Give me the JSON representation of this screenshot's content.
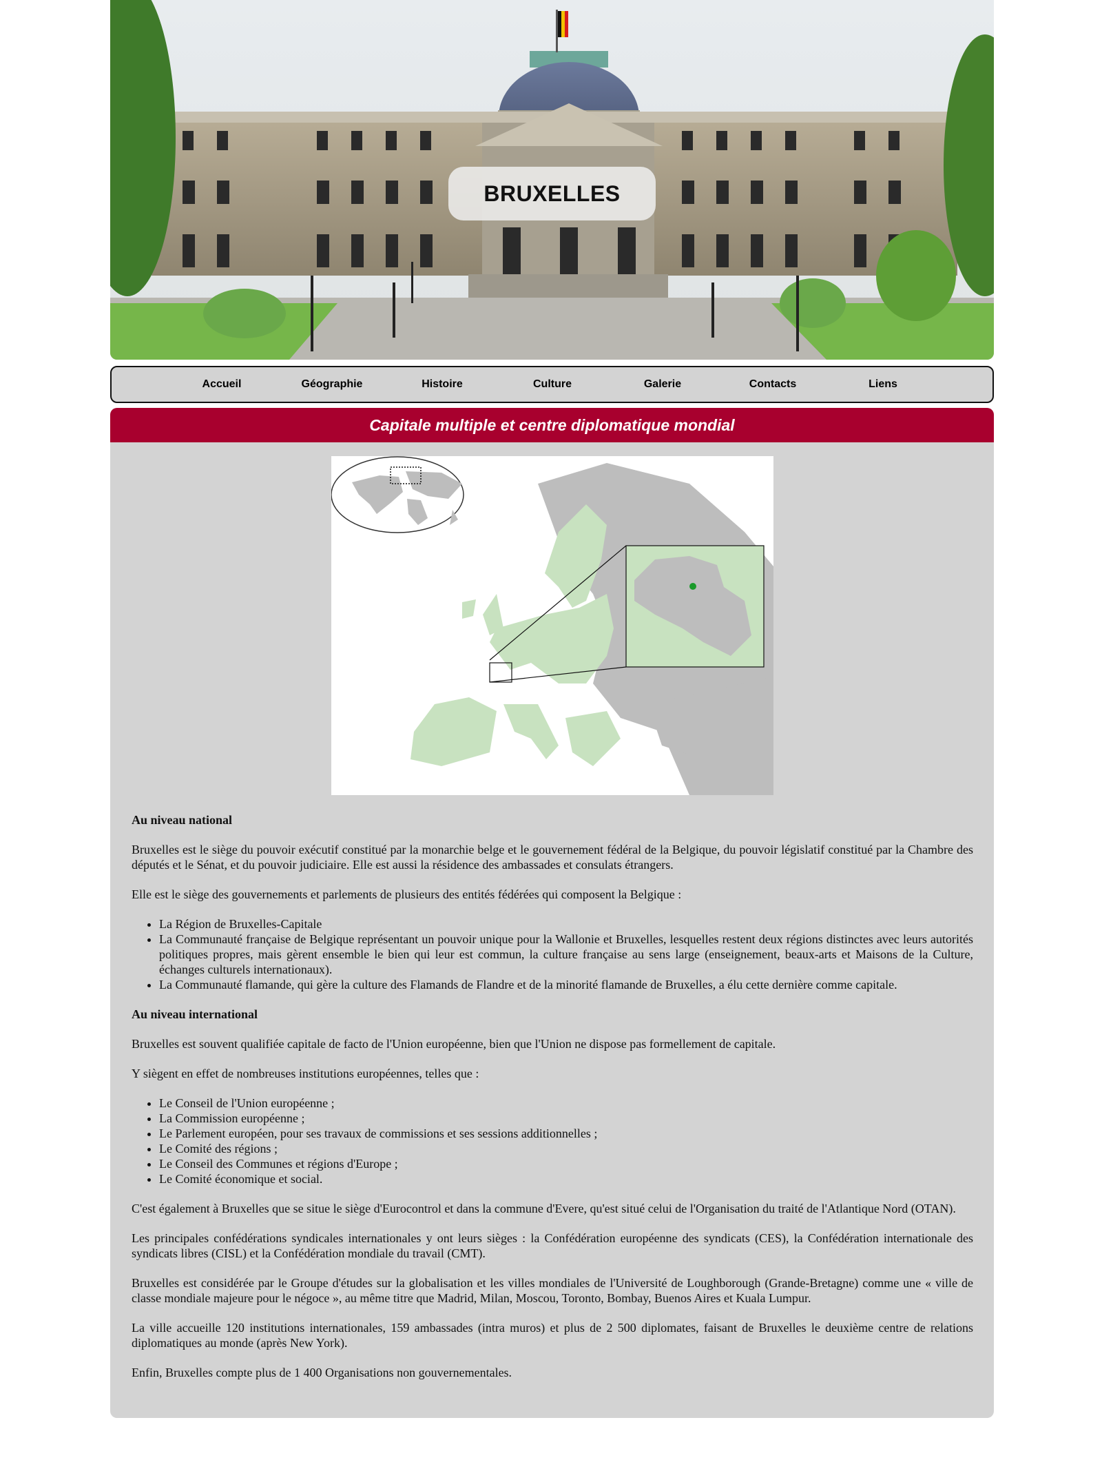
{
  "banner": {
    "title": "BRUXELLES"
  },
  "nav": {
    "items": [
      {
        "label": "Accueil"
      },
      {
        "label": "Géographie"
      },
      {
        "label": "Histoire"
      },
      {
        "label": "Culture"
      },
      {
        "label": "Galerie"
      },
      {
        "label": "Contacts"
      },
      {
        "label": "Liens"
      }
    ]
  },
  "section": {
    "heading": "Capitale multiple et centre diplomatique mondial",
    "national": {
      "heading": "Au niveau national",
      "p1": "Bruxelles est le siège du pouvoir exécutif constitué par la monarchie belge et le gouvernement fédéral de la Belgique, du pouvoir législatif constitué par la Chambre des députés et le Sénat, et du pouvoir judiciaire. Elle est aussi la résidence des ambassades et consulats étrangers.",
      "p2": "Elle est le siège des gouvernements et parlements de plusieurs des entités fédérées qui composent la Belgique :",
      "list": [
        "La Région de Bruxelles-Capitale",
        "La Communauté française de Belgique représentant un pouvoir unique pour la Wallonie et Bruxelles, lesquelles restent deux régions distinctes avec leurs autorités politiques propres, mais gèrent ensemble le bien qui leur est commun, la culture française au sens large (enseignement, beaux-arts et Maisons de la Culture, échanges culturels internationaux).",
        "La Communauté flamande, qui gère la culture des Flamands de Flandre et de la minorité flamande de Bruxelles, a élu cette dernière comme capitale."
      ]
    },
    "international": {
      "heading": "Au niveau international",
      "p1": "Bruxelles est souvent qualifiée capitale de facto de l'Union européenne, bien que l'Union ne dispose pas formellement de capitale.",
      "p2": "Y siègent en effet de nombreuses institutions européennes, telles que :",
      "list": [
        "Le Conseil de l'Union européenne ;",
        "La Commission européenne ;",
        "Le Parlement européen, pour ses travaux de commissions et ses sessions additionnelles ;",
        "Le Comité des régions ;",
        "Le Conseil des Communes et régions d'Europe ;",
        "Le Comité économique et social."
      ],
      "p3": "C'est également à Bruxelles que se situe le siège d'Eurocontrol et dans la commune d'Evere, qu'est situé celui de l'Organisation du traité de l'Atlantique Nord (OTAN).",
      "p4": "Les principales confédérations syndicales internationales y ont leurs sièges : la Confédération européenne des syndicats (CES), la Confédération internationale des syndicats libres (CISL) et la Confédération mondiale du travail (CMT).",
      "p5": "Bruxelles est considérée par le Groupe d'études sur la globalisation et les villes mondiales de l'Université de Loughborough (Grande-Bretagne) comme une « ville de classe mondiale majeure pour le négoce », au même titre que Madrid, Milan, Moscou, Toronto, Bombay, Buenos Aires et Kuala Lumpur.",
      "p6": "La ville accueille 120 institutions internationales, 159 ambassades (intra muros) et plus de 2 500 diplomates, faisant de Bruxelles le deuxième centre de relations diplomatiques au monde (après New York).",
      "p7": "Enfin, Bruxelles compte plus de 1 400 Organisations non gouvernementales."
    }
  },
  "colors": {
    "heading_bar": "#a8002e",
    "panel": "#d3d3d3",
    "map_eu": "#c8e2c0",
    "map_other": "#bdbdbd",
    "brussels": "#1a9a2a"
  }
}
